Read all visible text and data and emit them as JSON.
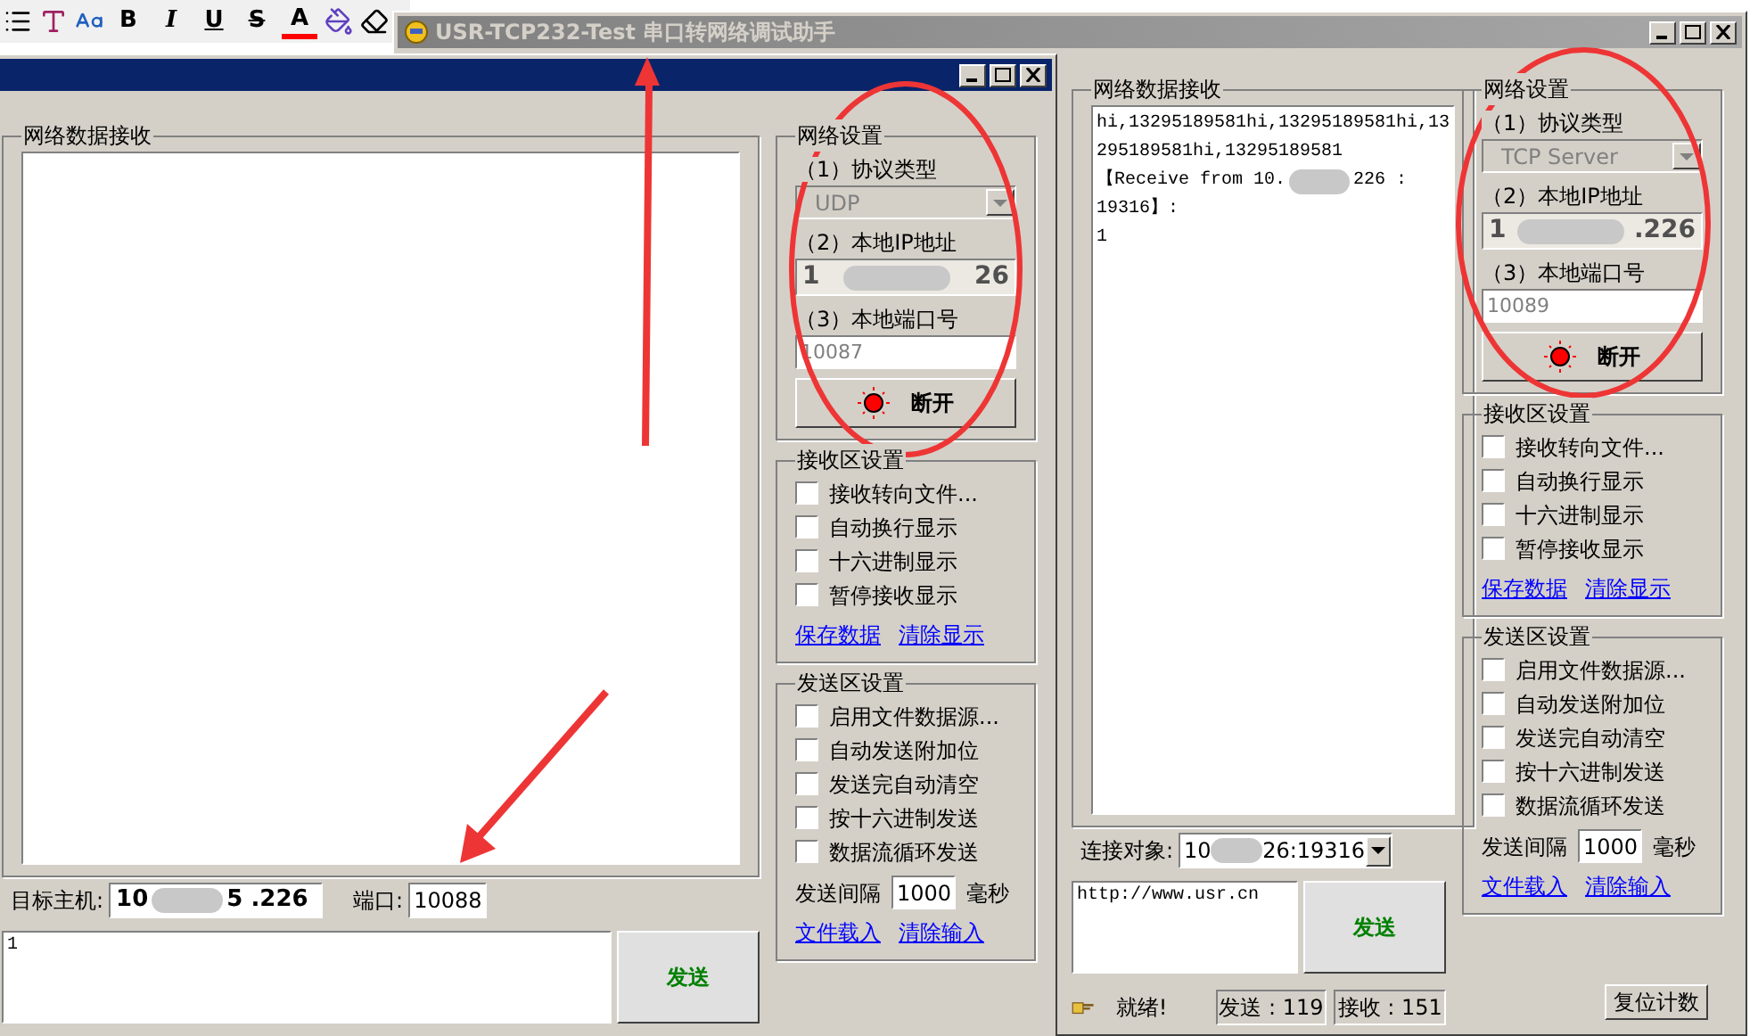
{
  "format_buttons": [
    {
      "kind": "bold",
      "text": "B"
    },
    {
      "kind": "italic",
      "text": "I"
    },
    {
      "kind": "underline",
      "text": "U"
    },
    {
      "kind": "strike",
      "text": "S"
    },
    {
      "kind": "font_color",
      "text": "A"
    }
  ],
  "back_window": {
    "title": "USR-TCP232-Test 串口转网络调试助手",
    "active": false,
    "receive": {
      "label": "网络数据接收",
      "lines": [
        {
          "parts": [
            "hi,13295189581hi,13295189581hi,13"
          ]
        },
        {
          "parts": [
            "295189581hi,13295189581"
          ]
        },
        {
          "parts": [
            "【Receive from 10.",
            "226 :"
          ]
        },
        {
          "parts": [
            "19316】:"
          ]
        },
        {
          "parts": [
            "1"
          ]
        }
      ]
    },
    "net": {
      "label": "网络设置",
      "protocol_label": "（1）协议类型",
      "protocol": "TCP Server",
      "ip_label": "（2）本地IP地址",
      "ip_prefix": "1",
      "ip_suffix": ".226",
      "port_label": "（3）本地端口号",
      "port": "10089",
      "connect_button": "断开"
    },
    "receive_settings": {
      "label": "接收区设置",
      "options": [
        {
          "label": "接收转向文件...",
          "checked": false
        },
        {
          "label": "自动换行显示",
          "checked": false
        },
        {
          "label": "十六进制显示",
          "checked": false
        },
        {
          "label": "暂停接收显示",
          "checked": false
        }
      ],
      "links": [
        "保存数据",
        "清除显示"
      ]
    },
    "send_settings": {
      "label": "发送区设置",
      "options": [
        {
          "label": "启用文件数据源...",
          "checked": false
        },
        {
          "label": "自动发送附加位",
          "checked": false
        },
        {
          "label": "发送完自动清空",
          "checked": false
        },
        {
          "label": "按十六进制发送",
          "checked": false
        },
        {
          "label": "数据流循环发送",
          "checked": false
        }
      ],
      "interval_label": "发送间隔",
      "interval": "1000",
      "interval_unit": "毫秒",
      "links": [
        "文件载入",
        "清除输入"
      ]
    },
    "target": {
      "kind": "combo",
      "label": "连接对象:",
      "prefix": "10",
      "suffix": "26:19316"
    },
    "send_text": "http://www.usr.cn",
    "send_button": "发送",
    "status": {
      "text": "就绪!",
      "sent": "发送 : 119",
      "received": "接收 : 151",
      "reset_button": "复位计数"
    }
  },
  "front_window": {
    "active": true,
    "receive": {
      "label": "网络数据接收"
    },
    "net": {
      "label": "网络设置",
      "protocol_label": "（1）协议类型",
      "protocol": "UDP",
      "ip_label": "（2）本地IP地址",
      "ip_prefix": "1",
      "ip_suffix": "26",
      "port_label": "（3）本地端口号",
      "port": "10087",
      "connect_button": "断开"
    },
    "receive_settings": {
      "label": "接收区设置",
      "options": [
        {
          "label": "接收转向文件...",
          "checked": false
        },
        {
          "label": "自动换行显示",
          "checked": false
        },
        {
          "label": "十六进制显示",
          "checked": false
        },
        {
          "label": "暂停接收显示",
          "checked": false
        }
      ],
      "links": [
        "保存数据",
        "清除显示"
      ]
    },
    "send_settings": {
      "label": "发送区设置",
      "options": [
        {
          "label": "启用文件数据源...",
          "checked": false
        },
        {
          "label": "自动发送附加位",
          "checked": false
        },
        {
          "label": "发送完自动清空",
          "checked": false
        },
        {
          "label": "按十六进制发送",
          "checked": false
        },
        {
          "label": "数据流循环发送",
          "checked": false
        }
      ],
      "interval_label": "发送间隔",
      "interval": "1000",
      "interval_unit": "毫秒",
      "links": [
        "文件载入",
        "清除输入"
      ]
    },
    "target": {
      "kind": "host_port",
      "label": "目标主机:",
      "prefix": "10",
      "suffix": "5 .226",
      "port_label": "端口:",
      "port": "10088"
    },
    "send_text": "1",
    "send_button": "发送"
  }
}
